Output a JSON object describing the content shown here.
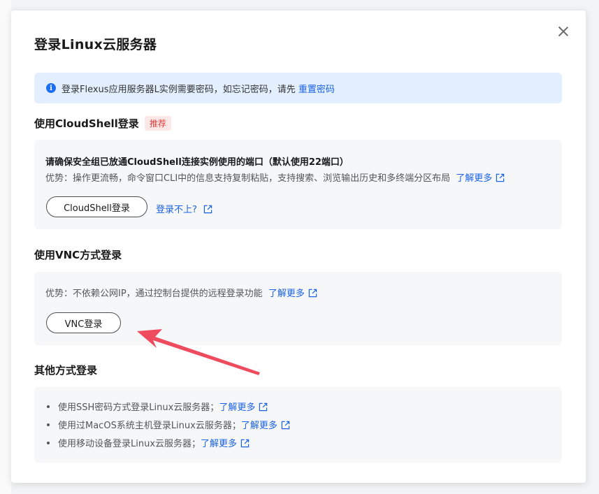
{
  "dialog": {
    "title": "登录Linux云服务器",
    "close_icon": "close-icon"
  },
  "alert": {
    "icon": "info-icon",
    "icon_glyph": "i",
    "text": "登录Flexus应用服务器L实例需要密码，如忘记密码，请先",
    "link": "重置密码"
  },
  "cloudshell": {
    "heading": "使用CloudShell登录",
    "badge": "推荐",
    "card_title": "请确保安全组已放通CloudShell连接实例使用的端口（默认使用22端口）",
    "advantage": "优势：操作更流畅，命令窗口CLI中的信息支持复制粘贴，支持搜索、浏览输出历史和多终端分区布局",
    "learn_more": "了解更多",
    "button": "CloudShell登录",
    "trouble_link": "登录不上?"
  },
  "vnc": {
    "heading": "使用VNC方式登录",
    "advantage": "优势：不依赖公网IP，通过控制台提供的远程登录功能",
    "learn_more": "了解更多",
    "button": "VNC登录"
  },
  "other": {
    "heading": "其他方式登录",
    "items": [
      {
        "text": "使用SSH密码方式登录Linux云服务器；",
        "link": "了解更多"
      },
      {
        "text": "使用过MacOS系统主机登录Linux云服务器；",
        "link": "了解更多"
      },
      {
        "text": "使用移动设备登录Linux云服务器；",
        "link": "了解更多"
      }
    ]
  },
  "colors": {
    "link": "#1a62e6",
    "alert_bg": "#e3efff",
    "badge_bg": "#fde8e8",
    "badge_text": "#e13b3b",
    "arrow": "#ef4b5f"
  }
}
